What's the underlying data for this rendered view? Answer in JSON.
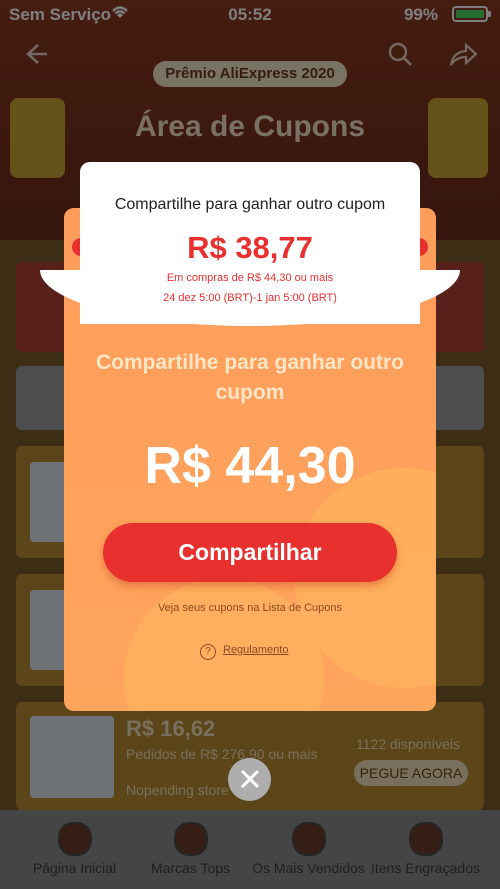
{
  "status": {
    "carrier": "Sem Serviço",
    "time": "05:52",
    "battery": "99%"
  },
  "header": {
    "badge": "Prêmio AliExpress 2020",
    "title": "Área de Cupons"
  },
  "background_items": [
    {
      "price": "R$ 16,62",
      "condition": "Pedidos de R$ 276,90 ou mais",
      "store": "Nopending store",
      "available": "1122 disponíveis",
      "button": "PEGUE AGORA"
    }
  ],
  "tabs": [
    {
      "label": "Página Inicial"
    },
    {
      "label": "Marcas Tops"
    },
    {
      "label": "Os Mais Vendidos"
    },
    {
      "label": "Itens Engraçados"
    }
  ],
  "modal": {
    "coupon_title": "Compartilhe para ganhar outro cupom",
    "coupon_price": "R$ 38,77",
    "coupon_condition": "Em compras de R$ 44,30 ou mais",
    "coupon_dates": "24 dez 5:00 (BRT)-1 jan 5:00 (BRT)",
    "heading": "Compartilhe para ganhar outro cupom",
    "amount": "R$ 44,30",
    "share_button": "Compartilhar",
    "note": "Veja seus cupons na Lista de Cupons",
    "rules_link": "Regulamento"
  },
  "colors": {
    "accent_red": "#e8302f",
    "modal_orange": "#ffa55c"
  }
}
